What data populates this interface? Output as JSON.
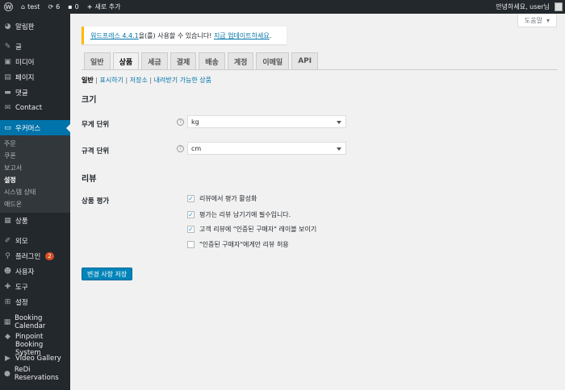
{
  "adminbar": {
    "site_name": "test",
    "updates_count": "6",
    "comments_count": "0",
    "new_label": "새로 추가",
    "greeting": "안녕하세요, user님"
  },
  "sidebar": {
    "items": [
      {
        "label": "알림판",
        "icon": "dashboard-icon",
        "glyph": "◕"
      },
      {
        "label": "글",
        "icon": "pin-icon",
        "glyph": "✎"
      },
      {
        "label": "미디어",
        "icon": "media-icon",
        "glyph": "▣"
      },
      {
        "label": "페이지",
        "icon": "page-icon",
        "glyph": "▤"
      },
      {
        "label": "댓글",
        "icon": "comment-icon",
        "glyph": "▬"
      },
      {
        "label": "Contact",
        "icon": "mail-icon",
        "glyph": "✉"
      },
      {
        "label": "우커머스",
        "icon": "woocommerce-icon",
        "glyph": "▭"
      }
    ],
    "woo_submenu": [
      "주문",
      "쿠폰",
      "보고서",
      "설정",
      "시스템 상태",
      "애드온"
    ],
    "items2": [
      {
        "label": "상품",
        "icon": "products-icon",
        "glyph": "▦"
      },
      {
        "label": "외모",
        "icon": "appearance-icon",
        "glyph": "✐"
      },
      {
        "label": "플러그인",
        "icon": "plugins-icon",
        "glyph": "⚲",
        "badge": "2"
      },
      {
        "label": "사용자",
        "icon": "users-icon",
        "glyph": "☻"
      },
      {
        "label": "도구",
        "icon": "tools-icon",
        "glyph": "✚"
      },
      {
        "label": "설정",
        "icon": "settings-icon",
        "glyph": "⊞"
      }
    ],
    "plugins": [
      {
        "label": "Booking Calendar",
        "icon": "calendar-icon",
        "glyph": "▦"
      },
      {
        "label": "Pinpoint Booking System",
        "icon": "pinpoint-icon",
        "glyph": "◆"
      },
      {
        "label": "Video Gallery",
        "icon": "video-icon",
        "glyph": "▶"
      },
      {
        "label": "ReDi Reservations",
        "icon": "redi-icon",
        "glyph": "●"
      }
    ]
  },
  "help_label": "도움말",
  "notice": {
    "link1": "워드프레스 4.4.1",
    "text": "을(를) 사용할 수 있습니다!",
    "link2": "지금 업데이트하세요",
    "end": "."
  },
  "tabs": [
    "일반",
    "상품",
    "세금",
    "결제",
    "배송",
    "계정",
    "이메일",
    "API"
  ],
  "subsub": {
    "current": "일반",
    "links": [
      "표시하기",
      "저장소",
      "내려받기 가능한 상품"
    ]
  },
  "sections": {
    "size_title": "크기",
    "weight_label": "무게 단위",
    "weight_value": "kg",
    "dimension_label": "규격 단위",
    "dimension_value": "cm",
    "reviews_title": "리뷰",
    "rating_label": "상품 평가"
  },
  "checks": [
    {
      "label": "리뷰에서 평가 활성화",
      "checked": true
    },
    {
      "label": "평가는 리뷰 남기기에 필수입니다.",
      "checked": true
    },
    {
      "label": "고객 리뷰에 \"인증된 구매자\" 레이블 보이기",
      "checked": true
    },
    {
      "label": "\"인증된 구매자\"에게만 리뷰 허용",
      "checked": false
    }
  ],
  "save_label": "변경 사항 저장"
}
